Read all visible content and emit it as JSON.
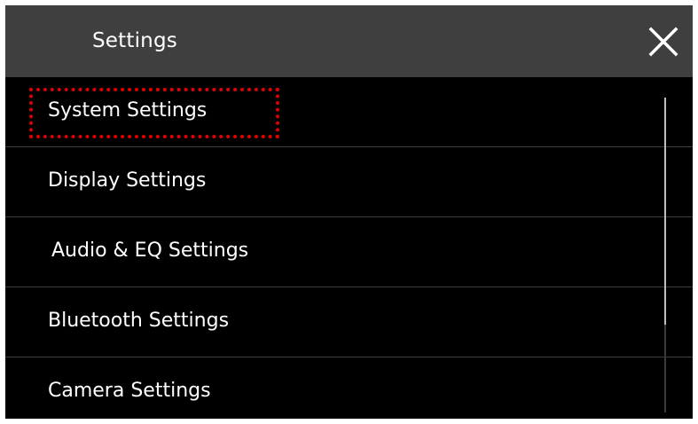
{
  "header": {
    "title": "Settings",
    "close_icon": "close-icon"
  },
  "menu": {
    "items": [
      {
        "label": "System Settings",
        "highlighted": true
      },
      {
        "label": "Display Settings",
        "highlighted": false
      },
      {
        "label": "Audio & EQ Settings",
        "highlighted": false
      },
      {
        "label": "Bluetooth Settings",
        "highlighted": false
      },
      {
        "label": "Camera Settings",
        "highlighted": false
      }
    ],
    "scroll_position_fraction": 0.0,
    "scroll_visible_fraction": 0.72
  },
  "colors": {
    "header_bg": "#3f3f3f",
    "list_bg": "#000000",
    "highlight": "#e00000",
    "text": "#ffffff"
  }
}
